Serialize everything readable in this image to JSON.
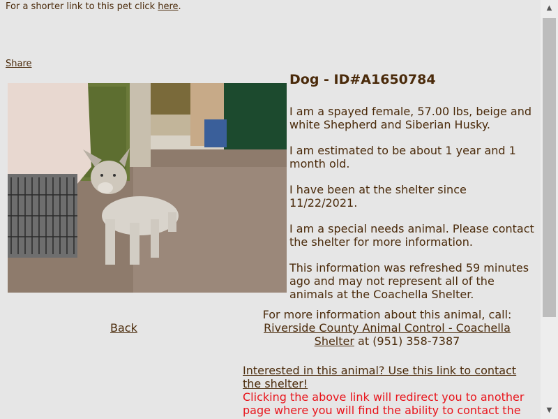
{
  "top_note": {
    "text": "For a shorter link to this pet click ",
    "link": "here",
    "end": "."
  },
  "share": "Share",
  "pet": {
    "title": "Dog - ID#A1650784",
    "paragraphs": [
      "I am a spayed female, 57.00 lbs, beige and white Shepherd and Siberian Husky.",
      "I am estimated to be about 1 year and 1 month old.",
      "I have been at the shelter since 11/22/2021.",
      "I am a special needs animal. Please contact the shelter for more information.",
      "This information was refreshed 59 minutes ago and may not represent all of the animals at the Coachella Shelter."
    ]
  },
  "back": "Back",
  "contact": {
    "intro": "For more information about this animal, call:",
    "shelter_link": "Riverside County Animal Control - Coachella Shelter",
    "phone": " at (951) 358-7387"
  },
  "interest": {
    "link": "Interested in this animal? Use this link to contact the shelter!",
    "warning": "Clicking the above link will redirect you to another page where you will find the ability to contact the shelter."
  },
  "colors": {
    "text": "#4a2a0a",
    "background": "#e6e6e6",
    "warning": "#e8141b"
  }
}
